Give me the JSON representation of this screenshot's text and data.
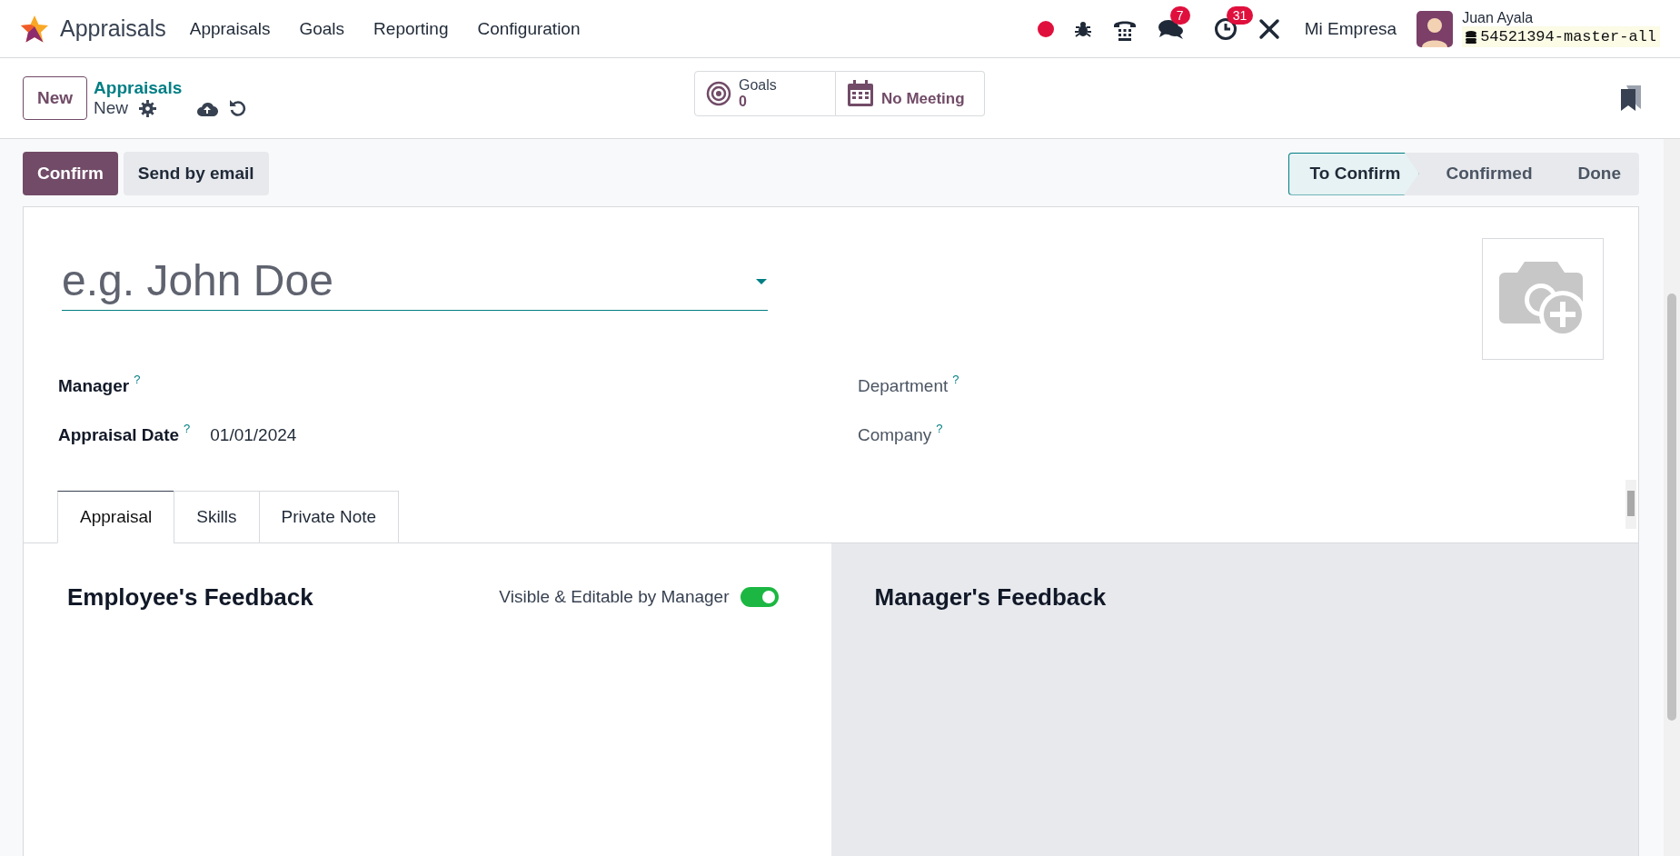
{
  "navbar": {
    "app_name": "Appraisals",
    "menu": [
      "Appraisals",
      "Goals",
      "Reporting",
      "Configuration"
    ],
    "messages_badge": "7",
    "activities_badge": "31",
    "company": "Mi Empresa",
    "user_name": "Juan Ayala",
    "database": "54521394-master-all"
  },
  "control_panel": {
    "new_button": "New",
    "breadcrumb": "Appraisals",
    "record_title": "New",
    "smart_buttons": [
      {
        "kind": "goals",
        "label": "Goals",
        "value": "0"
      },
      {
        "kind": "meeting",
        "label": "No Meeting"
      }
    ]
  },
  "actions": [
    {
      "label": "Confirm",
      "primary": true
    },
    {
      "label": "Send by email",
      "primary": false
    }
  ],
  "status_bar": [
    {
      "label": "To Confirm",
      "selected": true
    },
    {
      "label": "Confirmed",
      "selected": false
    },
    {
      "label": "Done",
      "selected": false
    }
  ],
  "form": {
    "name_placeholder": "e.g. John Doe",
    "left_fields": [
      {
        "label": "Manager",
        "help": "?",
        "required": true
      },
      {
        "label": "Appraisal Date",
        "help": "?",
        "required": true,
        "value": "01/01/2024"
      }
    ],
    "right_fields": [
      {
        "label": "Department",
        "help": "?",
        "required": false
      },
      {
        "label": "Company",
        "help": "?",
        "required": false
      }
    ],
    "tabs": [
      {
        "label": "Appraisal",
        "selected": true
      },
      {
        "label": "Skills",
        "selected": false
      },
      {
        "label": "Private Note",
        "selected": false
      }
    ],
    "employee_feedback": {
      "title": "Employee's Feedback",
      "toggle_label": "Visible & Editable by Manager",
      "on": true
    },
    "manager_feedback": {
      "title": "Manager's Feedback"
    }
  }
}
